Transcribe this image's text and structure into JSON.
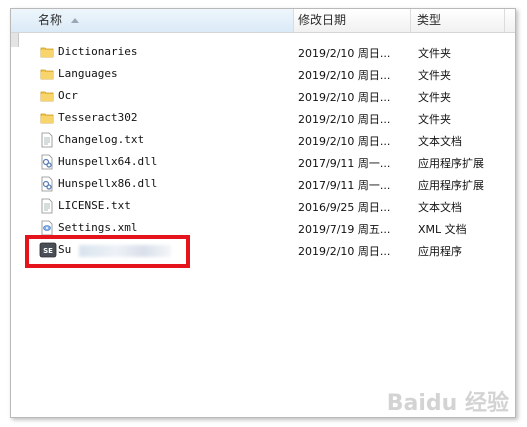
{
  "header": {
    "name": "名称",
    "date": "修改日期",
    "type": "类型"
  },
  "rows": [
    {
      "name": "Dictionaries",
      "date": "2019/2/10 周日...",
      "type": "文件夹",
      "icon": "folder-icon"
    },
    {
      "name": "Languages",
      "date": "2019/2/10 周日...",
      "type": "文件夹",
      "icon": "folder-icon"
    },
    {
      "name": "Ocr",
      "date": "2019/2/10 周日...",
      "type": "文件夹",
      "icon": "folder-icon"
    },
    {
      "name": "Tesseract302",
      "date": "2019/2/10 周日...",
      "type": "文件夹",
      "icon": "folder-icon"
    },
    {
      "name": "Changelog.txt",
      "date": "2019/2/10 周日...",
      "type": "文本文档",
      "icon": "text-file-icon"
    },
    {
      "name": "Hunspellx64.dll",
      "date": "2017/9/11 周一...",
      "type": "应用程序扩展",
      "icon": "dll-file-icon"
    },
    {
      "name": "Hunspellx86.dll",
      "date": "2017/9/11 周一...",
      "type": "应用程序扩展",
      "icon": "dll-file-icon"
    },
    {
      "name": "LICENSE.txt",
      "date": "2016/9/25 周日...",
      "type": "文本文档",
      "icon": "text-file-icon"
    },
    {
      "name": "Settings.xml",
      "date": "2019/7/19 周五...",
      "type": "XML 文档",
      "icon": "xml-file-icon"
    },
    {
      "name": "Su",
      "date": "2019/2/10 周日...",
      "type": "应用程序",
      "icon": "app-icon"
    }
  ],
  "app_icon_text": "SE",
  "watermark": "Baidu 经验",
  "colors": {
    "highlight": "#e5141c",
    "folder": "#f3c64a"
  }
}
